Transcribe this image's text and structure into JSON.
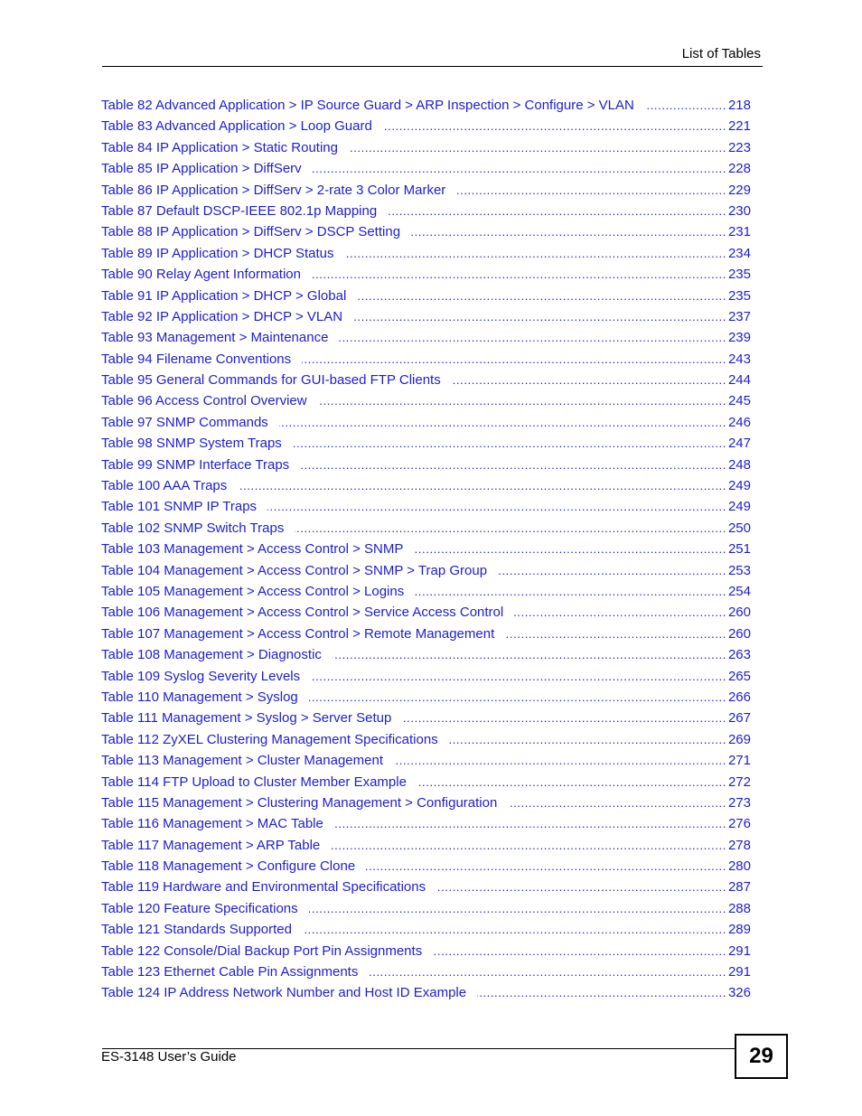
{
  "header": {
    "title": "List of Tables"
  },
  "entries": [
    {
      "label": "Table 82 Advanced Application > IP Source Guard > ARP Inspection > Configure > VLAN",
      "page": "218"
    },
    {
      "label": "Table 83 Advanced Application > Loop Guard",
      "page": "221"
    },
    {
      "label": "Table 84 IP Application > Static Routing",
      "page": "223"
    },
    {
      "label": "Table 85 IP Application > DiffServ",
      "page": "228"
    },
    {
      "label": "Table 86 IP Application > DiffServ > 2-rate 3 Color Marker",
      "page": "229"
    },
    {
      "label": "Table 87 Default DSCP-IEEE 802.1p Mapping",
      "page": "230"
    },
    {
      "label": "Table 88 IP Application > DiffServ > DSCP Setting",
      "page": "231"
    },
    {
      "label": "Table 89 IP Application > DHCP Status",
      "page": "234"
    },
    {
      "label": "Table 90 Relay Agent Information",
      "page": "235"
    },
    {
      "label": "Table 91 IP Application > DHCP > Global",
      "page": "235"
    },
    {
      "label": "Table 92 IP Application > DHCP > VLAN",
      "page": "237"
    },
    {
      "label": "Table 93 Management > Maintenance",
      "page": "239"
    },
    {
      "label": "Table 94 Filename Conventions",
      "page": "243"
    },
    {
      "label": "Table 95 General Commands for GUI-based FTP Clients",
      "page": "244"
    },
    {
      "label": "Table 96 Access Control Overview",
      "page": "245"
    },
    {
      "label": "Table 97 SNMP Commands",
      "page": "246"
    },
    {
      "label": "Table 98 SNMP System Traps",
      "page": "247"
    },
    {
      "label": "Table 99 SNMP Interface Traps",
      "page": "248"
    },
    {
      "label": "Table 100 AAA Traps",
      "page": "249"
    },
    {
      "label": "Table 101 SNMP IP Traps",
      "page": "249"
    },
    {
      "label": "Table 102 SNMP Switch Traps",
      "page": "250"
    },
    {
      "label": "Table 103 Management > Access Control > SNMP",
      "page": "251"
    },
    {
      "label": "Table 104 Management > Access Control > SNMP > Trap Group",
      "page": "253"
    },
    {
      "label": "Table 105 Management > Access Control > Logins",
      "page": "254"
    },
    {
      "label": "Table 106 Management > Access Control > Service Access Control",
      "page": "260"
    },
    {
      "label": "Table 107 Management > Access Control > Remote Management",
      "page": "260"
    },
    {
      "label": "Table 108 Management > Diagnostic",
      "page": "263"
    },
    {
      "label": "Table 109 Syslog Severity Levels",
      "page": "265"
    },
    {
      "label": "Table 110 Management > Syslog",
      "page": "266"
    },
    {
      "label": "Table 111 Management > Syslog > Server Setup",
      "page": "267"
    },
    {
      "label": "Table 112 ZyXEL Clustering Management Specifications",
      "page": "269"
    },
    {
      "label": "Table 113 Management > Cluster Management",
      "page": "271"
    },
    {
      "label": "Table 114 FTP Upload to Cluster Member Example",
      "page": "272"
    },
    {
      "label": "Table 115 Management > Clustering Management > Configuration",
      "page": "273"
    },
    {
      "label": "Table 116 Management > MAC Table",
      "page": "276"
    },
    {
      "label": "Table 117 Management > ARP Table",
      "page": "278"
    },
    {
      "label": "Table 118 Management > Configure Clone",
      "page": "280"
    },
    {
      "label": "Table 119 Hardware and Environmental Specifications",
      "page": "287"
    },
    {
      "label": "Table 120 Feature Specifications",
      "page": "288"
    },
    {
      "label": "Table 121 Standards Supported",
      "page": "289"
    },
    {
      "label": "Table 122 Console/Dial Backup Port Pin Assignments",
      "page": "291"
    },
    {
      "label": "Table 123 Ethernet Cable Pin Assignments",
      "page": "291"
    },
    {
      "label": "Table 124 IP Address Network Number and Host ID Example",
      "page": "326"
    }
  ],
  "leader": "........................................................................................................................................................",
  "footer": {
    "title": "ES-3148 User’s Guide",
    "page_number": "29"
  },
  "colors": {
    "link": "#1d1dd4",
    "text": "#000000"
  }
}
